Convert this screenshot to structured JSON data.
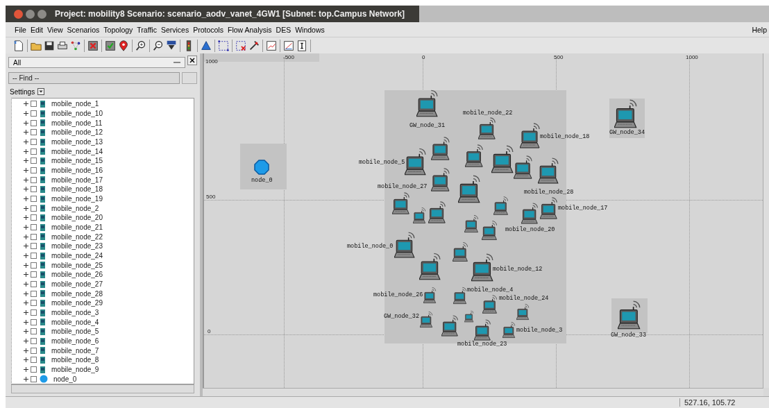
{
  "window": {
    "title": "Project: mobility8 Scenario: scenario_aodv_vanet_4GW1  [Subnet: top.Campus Network]"
  },
  "menu": [
    "File",
    "Edit",
    "View",
    "Scenarios",
    "Topology",
    "Traffic",
    "Services",
    "Protocols",
    "Flow Analysis",
    "DES",
    "Windows"
  ],
  "menu_right": "Help",
  "object_panel": {
    "filter": "All",
    "find": {
      "placeholder": "-- Find --"
    },
    "settings_label": "Settings",
    "tree": [
      {
        "label": "mobile_node_1",
        "kind": "mobile",
        "checked": false,
        "expanded": false
      },
      {
        "label": "mobile_node_10",
        "kind": "mobile",
        "checked": false,
        "expanded": false
      },
      {
        "label": "mobile_node_11",
        "kind": "mobile",
        "checked": false,
        "expanded": false
      },
      {
        "label": "mobile_node_12",
        "kind": "mobile",
        "checked": false,
        "expanded": false
      },
      {
        "label": "mobile_node_13",
        "kind": "mobile",
        "checked": false,
        "expanded": false
      },
      {
        "label": "mobile_node_14",
        "kind": "mobile",
        "checked": false,
        "expanded": false
      },
      {
        "label": "mobile_node_15",
        "kind": "mobile",
        "checked": false,
        "expanded": false
      },
      {
        "label": "mobile_node_16",
        "kind": "mobile",
        "checked": false,
        "expanded": false
      },
      {
        "label": "mobile_node_17",
        "kind": "mobile",
        "checked": false,
        "expanded": false
      },
      {
        "label": "mobile_node_18",
        "kind": "mobile",
        "checked": false,
        "expanded": false
      },
      {
        "label": "mobile_node_19",
        "kind": "mobile",
        "checked": false,
        "expanded": false
      },
      {
        "label": "mobile_node_2",
        "kind": "mobile",
        "checked": false,
        "expanded": false
      },
      {
        "label": "mobile_node_20",
        "kind": "mobile",
        "checked": false,
        "expanded": false
      },
      {
        "label": "mobile_node_21",
        "kind": "mobile",
        "checked": false,
        "expanded": false
      },
      {
        "label": "mobile_node_22",
        "kind": "mobile",
        "checked": false,
        "expanded": false
      },
      {
        "label": "mobile_node_23",
        "kind": "mobile",
        "checked": false,
        "expanded": false
      },
      {
        "label": "mobile_node_24",
        "kind": "mobile",
        "checked": false,
        "expanded": false
      },
      {
        "label": "mobile_node_25",
        "kind": "mobile",
        "checked": false,
        "expanded": false
      },
      {
        "label": "mobile_node_26",
        "kind": "mobile",
        "checked": false,
        "expanded": false
      },
      {
        "label": "mobile_node_27",
        "kind": "mobile",
        "checked": false,
        "expanded": false
      },
      {
        "label": "mobile_node_28",
        "kind": "mobile",
        "checked": false,
        "expanded": false
      },
      {
        "label": "mobile_node_29",
        "kind": "mobile",
        "checked": false,
        "expanded": false
      },
      {
        "label": "mobile_node_3",
        "kind": "mobile",
        "checked": false,
        "expanded": false
      },
      {
        "label": "mobile_node_4",
        "kind": "mobile",
        "checked": false,
        "expanded": false
      },
      {
        "label": "mobile_node_5",
        "kind": "mobile",
        "checked": false,
        "expanded": false
      },
      {
        "label": "mobile_node_6",
        "kind": "mobile",
        "checked": false,
        "expanded": false
      },
      {
        "label": "mobile_node_7",
        "kind": "mobile",
        "checked": false,
        "expanded": false
      },
      {
        "label": "mobile_node_8",
        "kind": "mobile",
        "checked": false,
        "expanded": false
      },
      {
        "label": "mobile_node_9",
        "kind": "mobile",
        "checked": false,
        "expanded": false
      },
      {
        "label": "node_0",
        "kind": "router",
        "checked": false,
        "expanded": false
      }
    ]
  },
  "canvas": {
    "x_ruler": [
      "-500",
      "0",
      "500",
      "1000"
    ],
    "y_ruler": [
      "1000",
      "500",
      "0"
    ],
    "nodes": [
      {
        "kind": "laptop",
        "label": "GW_node_31"
      },
      {
        "kind": "laptop",
        "label": "mobile_node_22"
      },
      {
        "kind": "laptop",
        "label": "mobile_node_18"
      },
      {
        "kind": "laptop"
      },
      {
        "kind": "laptop",
        "label": "mobile_node_5"
      },
      {
        "kind": "laptop"
      },
      {
        "kind": "laptop"
      },
      {
        "kind": "laptop"
      },
      {
        "kind": "laptop",
        "label": "mobile_node_28"
      },
      {
        "kind": "laptop",
        "label": "mobile_node_27"
      },
      {
        "kind": "laptop"
      },
      {
        "kind": "laptop"
      },
      {
        "kind": "laptop"
      },
      {
        "kind": "laptop"
      },
      {
        "kind": "laptop"
      },
      {
        "kind": "laptop",
        "label": "mobile_node_20"
      },
      {
        "kind": "laptop",
        "label": "mobile_node_17"
      },
      {
        "kind": "laptop"
      },
      {
        "kind": "laptop"
      },
      {
        "kind": "laptop",
        "label": "mobile_node_0"
      },
      {
        "kind": "laptop"
      },
      {
        "kind": "laptop"
      },
      {
        "kind": "laptop",
        "label": "mobile_node_12"
      },
      {
        "kind": "laptop",
        "label": "mobile_node_4"
      },
      {
        "kind": "laptop",
        "label": "mobile_node_26"
      },
      {
        "kind": "laptop",
        "label": "mobile_node_24"
      },
      {
        "kind": "laptop"
      },
      {
        "kind": "laptop",
        "label": "GW_node_32"
      },
      {
        "kind": "laptop"
      },
      {
        "kind": "laptop"
      },
      {
        "kind": "laptop",
        "label": "mobile_node_23"
      },
      {
        "kind": "laptop",
        "label": "mobile_node_3"
      },
      {
        "kind": "laptop",
        "label": "GW_node_34"
      },
      {
        "kind": "laptop",
        "label": "GW_node_33"
      },
      {
        "kind": "router",
        "label": "node_0"
      }
    ]
  },
  "status_bar": {
    "coordinates": "527.16, 105.72"
  }
}
